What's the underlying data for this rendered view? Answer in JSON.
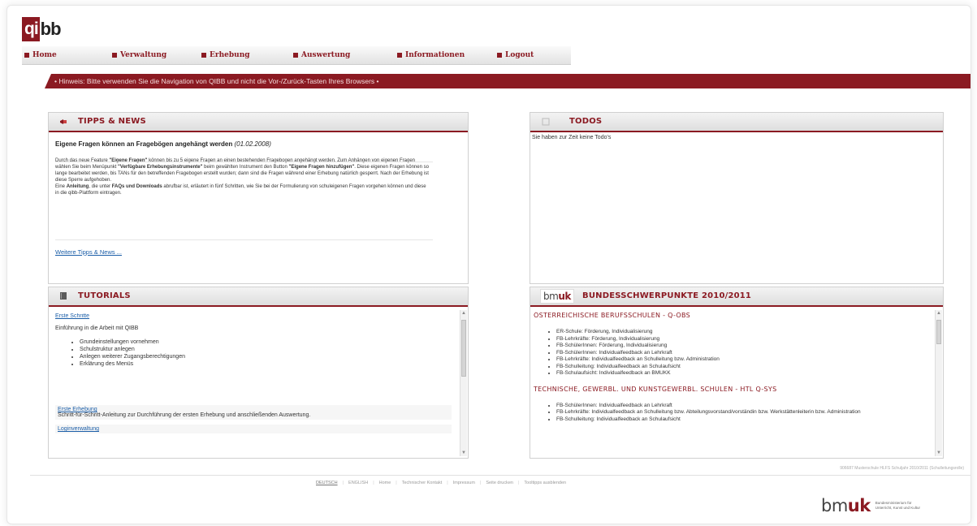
{
  "logo": {
    "part1": "qi",
    "part2": "bb"
  },
  "nav": {
    "items": [
      {
        "label": "Home"
      },
      {
        "label": "Verwaltung"
      },
      {
        "label": "Erhebung"
      },
      {
        "label": "Auswertung"
      },
      {
        "label": "Informationen"
      },
      {
        "label": "Logout"
      }
    ]
  },
  "hint": {
    "text": "• Hinweis: Bitte verwenden Sie die Navigation von QIBB und nicht die Vor-/Zurück-Tasten Ihres Browsers •"
  },
  "tipps": {
    "title": "TIPPS & NEWS",
    "headline": "Eigene Fragen können an Fragebögen angehängt werden",
    "date": "(01.02.2008)",
    "p1": "Durch das neue Feature ",
    "b1": "\"Eigene Fragen\"",
    "p2": " können bis zu 5 eigene Fragen an einen bestehenden Fragebogen angehängt werden. Zum Anhängen von eigenen Fragen wählen Sie beim Menüpunkt ",
    "b2": "\"Verfügbare Erhebungsinstrumente\"",
    "p3": " beim gewählten Instrument den Button ",
    "b3": "\"Eigene Fragen hinzufügen\"",
    "p4": ". Diese eigenen Fragen können so lange bearbeitet werden, bis TANs für den betreffenden Fragebogen erstellt wurden; dann sind die Fragen während einer Erhebung natürlich gesperrt. Nach der Erhebung ist diese Sperre aufgehoben.",
    "p5": "Eine ",
    "b5": "Anleitung",
    "p6": ", die unter ",
    "b6": "FAQs und Downloads",
    "p7": " abrufbar ist, erläutert in fünf Schritten, wie Sie bei der Formulierung von schuleigenen Fragen vorgehen können und diese in die qibb-Plattform eintragen.",
    "more_link": "Weitere Tipps & News ..."
  },
  "todos": {
    "title": "TODOS",
    "text": "Sie haben zur Zeit keine Todo's"
  },
  "tutorials": {
    "title": "TUTORIALS",
    "t1_link": "Erste Schritte",
    "t1_desc": "Einführung in die Arbeit mit QIBB",
    "t1_items": [
      "Grundeinstellungen vornehmen",
      "Schulstruktur anlegen",
      "Anlegen weiterer Zugangsberechtigungen",
      "Erklärung des Menüs"
    ],
    "t2_link": "Erste Erhebung",
    "t2_desc": "Schritt-für-Schritt-Anleitung zur Durchführung der ersten Erhebung und anschließenden Auswertung.",
    "t3_link": "Loginverwaltung"
  },
  "schwerpunkte": {
    "logo_bm": "bm",
    "logo_uk": "uk",
    "title": "BUNDESSCHWERPUNKTE 2010/2011",
    "s1_title": "ÖSTERREICHISCHE BERUFSSCHULEN - Q-ÖBS",
    "s1_items": [
      "ER-Schule: Förderung, Individualisierung",
      "FB-Lehrkräfte: Förderung, Individualisierung",
      "FB-SchülerInnen: Förderung, Individualisierung",
      "FB-SchülerInnen: Individualfeedback an Lehrkraft",
      "FB-Lehrkräfte: Individualfeedback an Schulleitung bzw. Administration",
      "FB-Schulleitung: Individualfeedback an Schulaufsicht",
      "FB-Schulaufsicht: Individualfeedback an BMUKK"
    ],
    "s2_title": "TECHNISCHE, GEWERBL. UND KUNSTGEWERBL. SCHULEN - HTL Q-SYS",
    "s2_items": [
      "FB-SchülerInnen: Individualfeedback an Lehrkraft",
      "FB-Lehrkräfte: Individualfeedback an Schulleitung bzw. Abteilungsvorstand/vorständin bzw. Werkstättenleiterin bzw. Administration",
      "FB-Schulleitung: Individualfeedback an Schulaufsicht"
    ]
  },
  "footer": {
    "status": "906687 Musterschule HLFS Schuljahr 2010/2011 (Schulleitungsrolle)",
    "links": [
      "DEUTSCH",
      "ENGLISH",
      "Home",
      "Technischer Kontakt",
      "Impressum",
      "Seite drucken",
      "Tooltipps ausblenden"
    ],
    "logo_bm": "bm",
    "logo_uk": "uk",
    "ministry_line1": "Bundesministerium für",
    "ministry_line2": "Unterricht, Kunst und Kultur"
  },
  "colors": {
    "accent": "#8b1a22",
    "link": "#1b5ea8"
  }
}
